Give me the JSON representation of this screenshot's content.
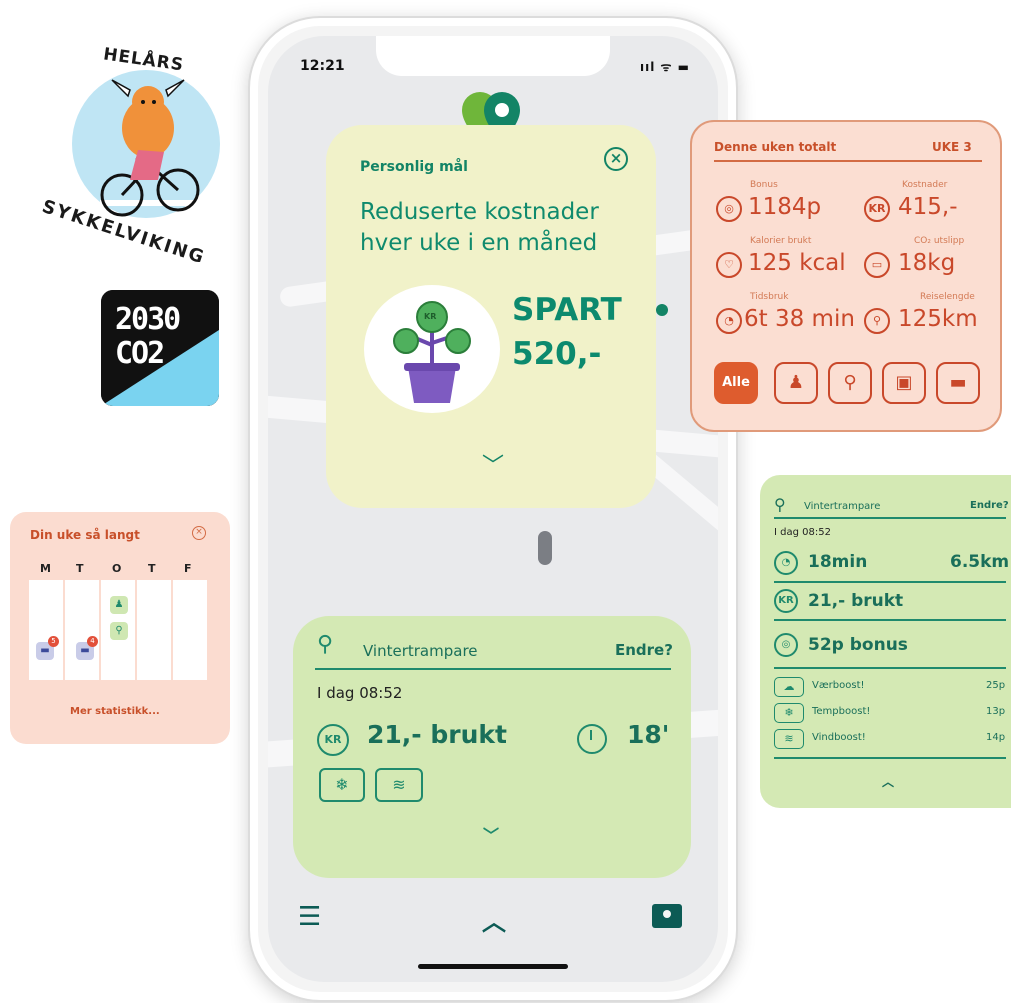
{
  "status_bar": {
    "time": "12:21",
    "icons": "ııl ᯤ ▬"
  },
  "goal_card": {
    "title": "Personlig mål",
    "description": "Reduserte kostnader hver uke i en måned",
    "spart_label": "SPART",
    "spart_value": "520,-",
    "plant_coin": "KR"
  },
  "trip_card": {
    "transport_name": "Vintertrampare",
    "edit_label": "Endre?",
    "timestamp": "I dag 08:52",
    "cost_badge": "KR",
    "cost_text": "21,- brukt",
    "duration": "18'"
  },
  "totals_panel": {
    "title": "Denne uken totalt",
    "week": "UKE 3",
    "stats": [
      {
        "label": "Bonus",
        "value": "1184p",
        "icon": "bonus-icon"
      },
      {
        "label": "Kostnader",
        "value": "415,-",
        "icon": "kr-icon",
        "icon_text": "KR"
      },
      {
        "label": "Kalorier brukt",
        "value": "125 kcal",
        "icon": "heart-icon"
      },
      {
        "label": "CO₂ utslipp",
        "value": "18kg",
        "icon": "co2-icon"
      },
      {
        "label": "Tidsbruk",
        "value": "6t 38 min",
        "icon": "clock-icon"
      },
      {
        "label": "Reiselengde",
        "value": "125km",
        "icon": "location-icon"
      }
    ],
    "modes": [
      {
        "label": "Alle",
        "active": true
      },
      {
        "icon": "walk-icon"
      },
      {
        "icon": "bike-icon"
      },
      {
        "icon": "bus-icon"
      },
      {
        "icon": "car-icon"
      }
    ]
  },
  "detail_panel": {
    "transport_name": "Vintertrampare",
    "edit_label": "Endre?",
    "timestamp": "I dag 08:52",
    "duration": "18min",
    "distance": "6.5km",
    "cost_badge": "KR",
    "cost_text": "21,- brukt",
    "bonus_text": "52p bonus",
    "boosts": [
      {
        "label": "Værboost!",
        "points": "25p"
      },
      {
        "label": "Tempboost!",
        "points": "13p"
      },
      {
        "label": "Vindboost!",
        "points": "14p"
      }
    ]
  },
  "week_panel": {
    "title": "Din uke så langt",
    "days": [
      "M",
      "T",
      "O",
      "T",
      "F"
    ],
    "badges": [
      "5",
      "4"
    ],
    "more_link": "Mer statistikk..."
  },
  "badges": {
    "top_arc": "HELÅRS",
    "bottom_arc": "SYKKELVIKING",
    "co2_top": "2030",
    "co2_bottom": "CO2"
  },
  "colors": {
    "brand_green": "#138466",
    "card_yellow": "#f1f2c9",
    "card_green": "#d4e9b4",
    "accent_orange": "#de5c2e",
    "panel_peach": "#fbded2"
  }
}
